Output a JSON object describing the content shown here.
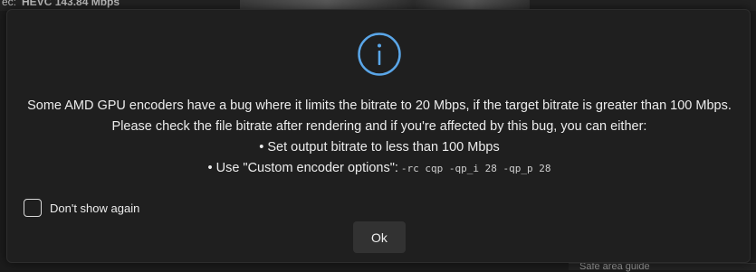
{
  "background": {
    "codec_label": "ec:",
    "codec_value": "HEVC 143.84 Mbps",
    "panel_label": "Safe area guide"
  },
  "dialog": {
    "icon": "info-icon",
    "accent_color": "#5aa6e8",
    "message_lines": [
      "Some AMD GPU encoders have a bug where it limits the bitrate to 20 Mbps, if the target bitrate is greater than 100 Mbps.",
      "Please check the file bitrate after rendering and if you're affected by this bug, you can either:",
      "• Set output bitrate to less than 100 Mbps",
      "• Use \"Custom encoder options\":"
    ],
    "encoder_options_code": "-rc cqp -qp_i 28 -qp_p 28",
    "dont_show_label": "Don't show again",
    "dont_show_checked": false,
    "ok_label": "Ok"
  }
}
